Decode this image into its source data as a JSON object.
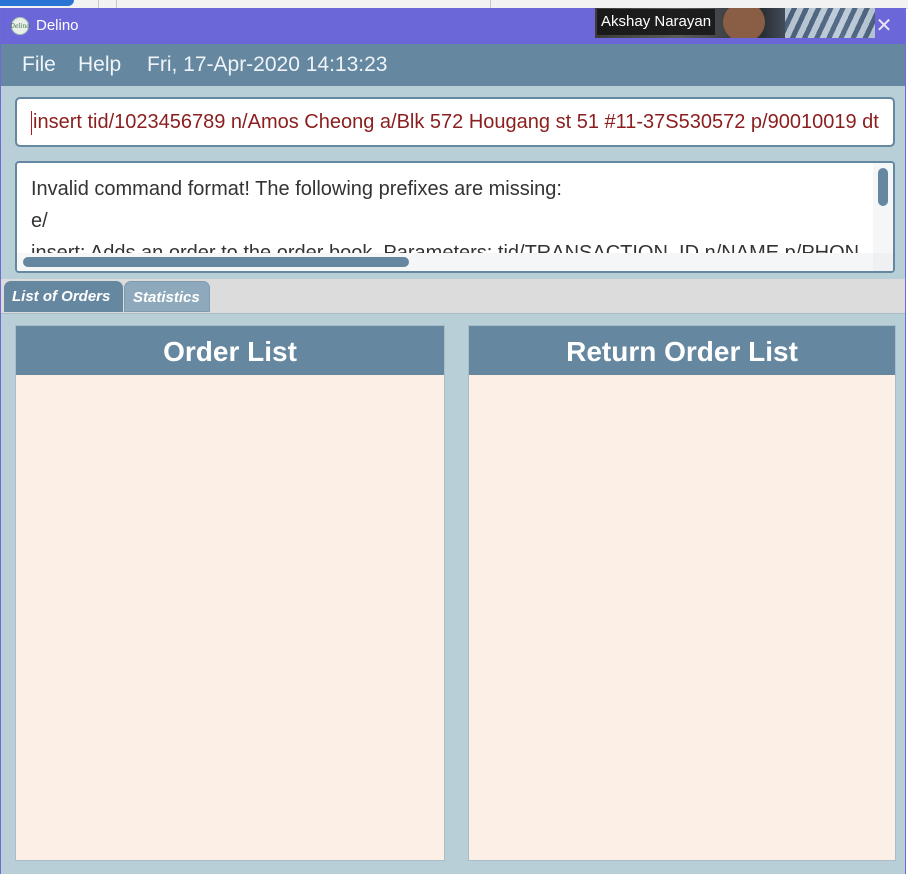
{
  "window": {
    "title": "Delino",
    "app_icon_text": "Delino",
    "close_symbol": "✕"
  },
  "overlay": {
    "webcam_name": "Akshay Narayan"
  },
  "menu": {
    "file": "File",
    "help": "Help",
    "datetime": "Fri, 17-Apr-2020 14:13:23"
  },
  "command": {
    "value": "insert tid/1023456789 n/Amos Cheong a/Blk 572 Hougang st 51 #11-37S530572 p/90010019 dt"
  },
  "result": {
    "text": "Invalid command format! The following prefixes are missing:\ne/\ninsert: Adds an order to the order book. Parameters: tid/TRANSACTION_ID n/NAME p/PHON"
  },
  "tabs": [
    {
      "label": "List of Orders",
      "active": true
    },
    {
      "label": "Statistics",
      "active": false
    }
  ],
  "panels": {
    "order_list_title": "Order List",
    "return_order_list_title": "Return Order List"
  },
  "colors": {
    "titlebar": "#6b67d9",
    "menubar": "#6587a0",
    "background": "#b8cfd8",
    "panel_body": "#fbefe6",
    "command_text": "#8b1e1e"
  }
}
